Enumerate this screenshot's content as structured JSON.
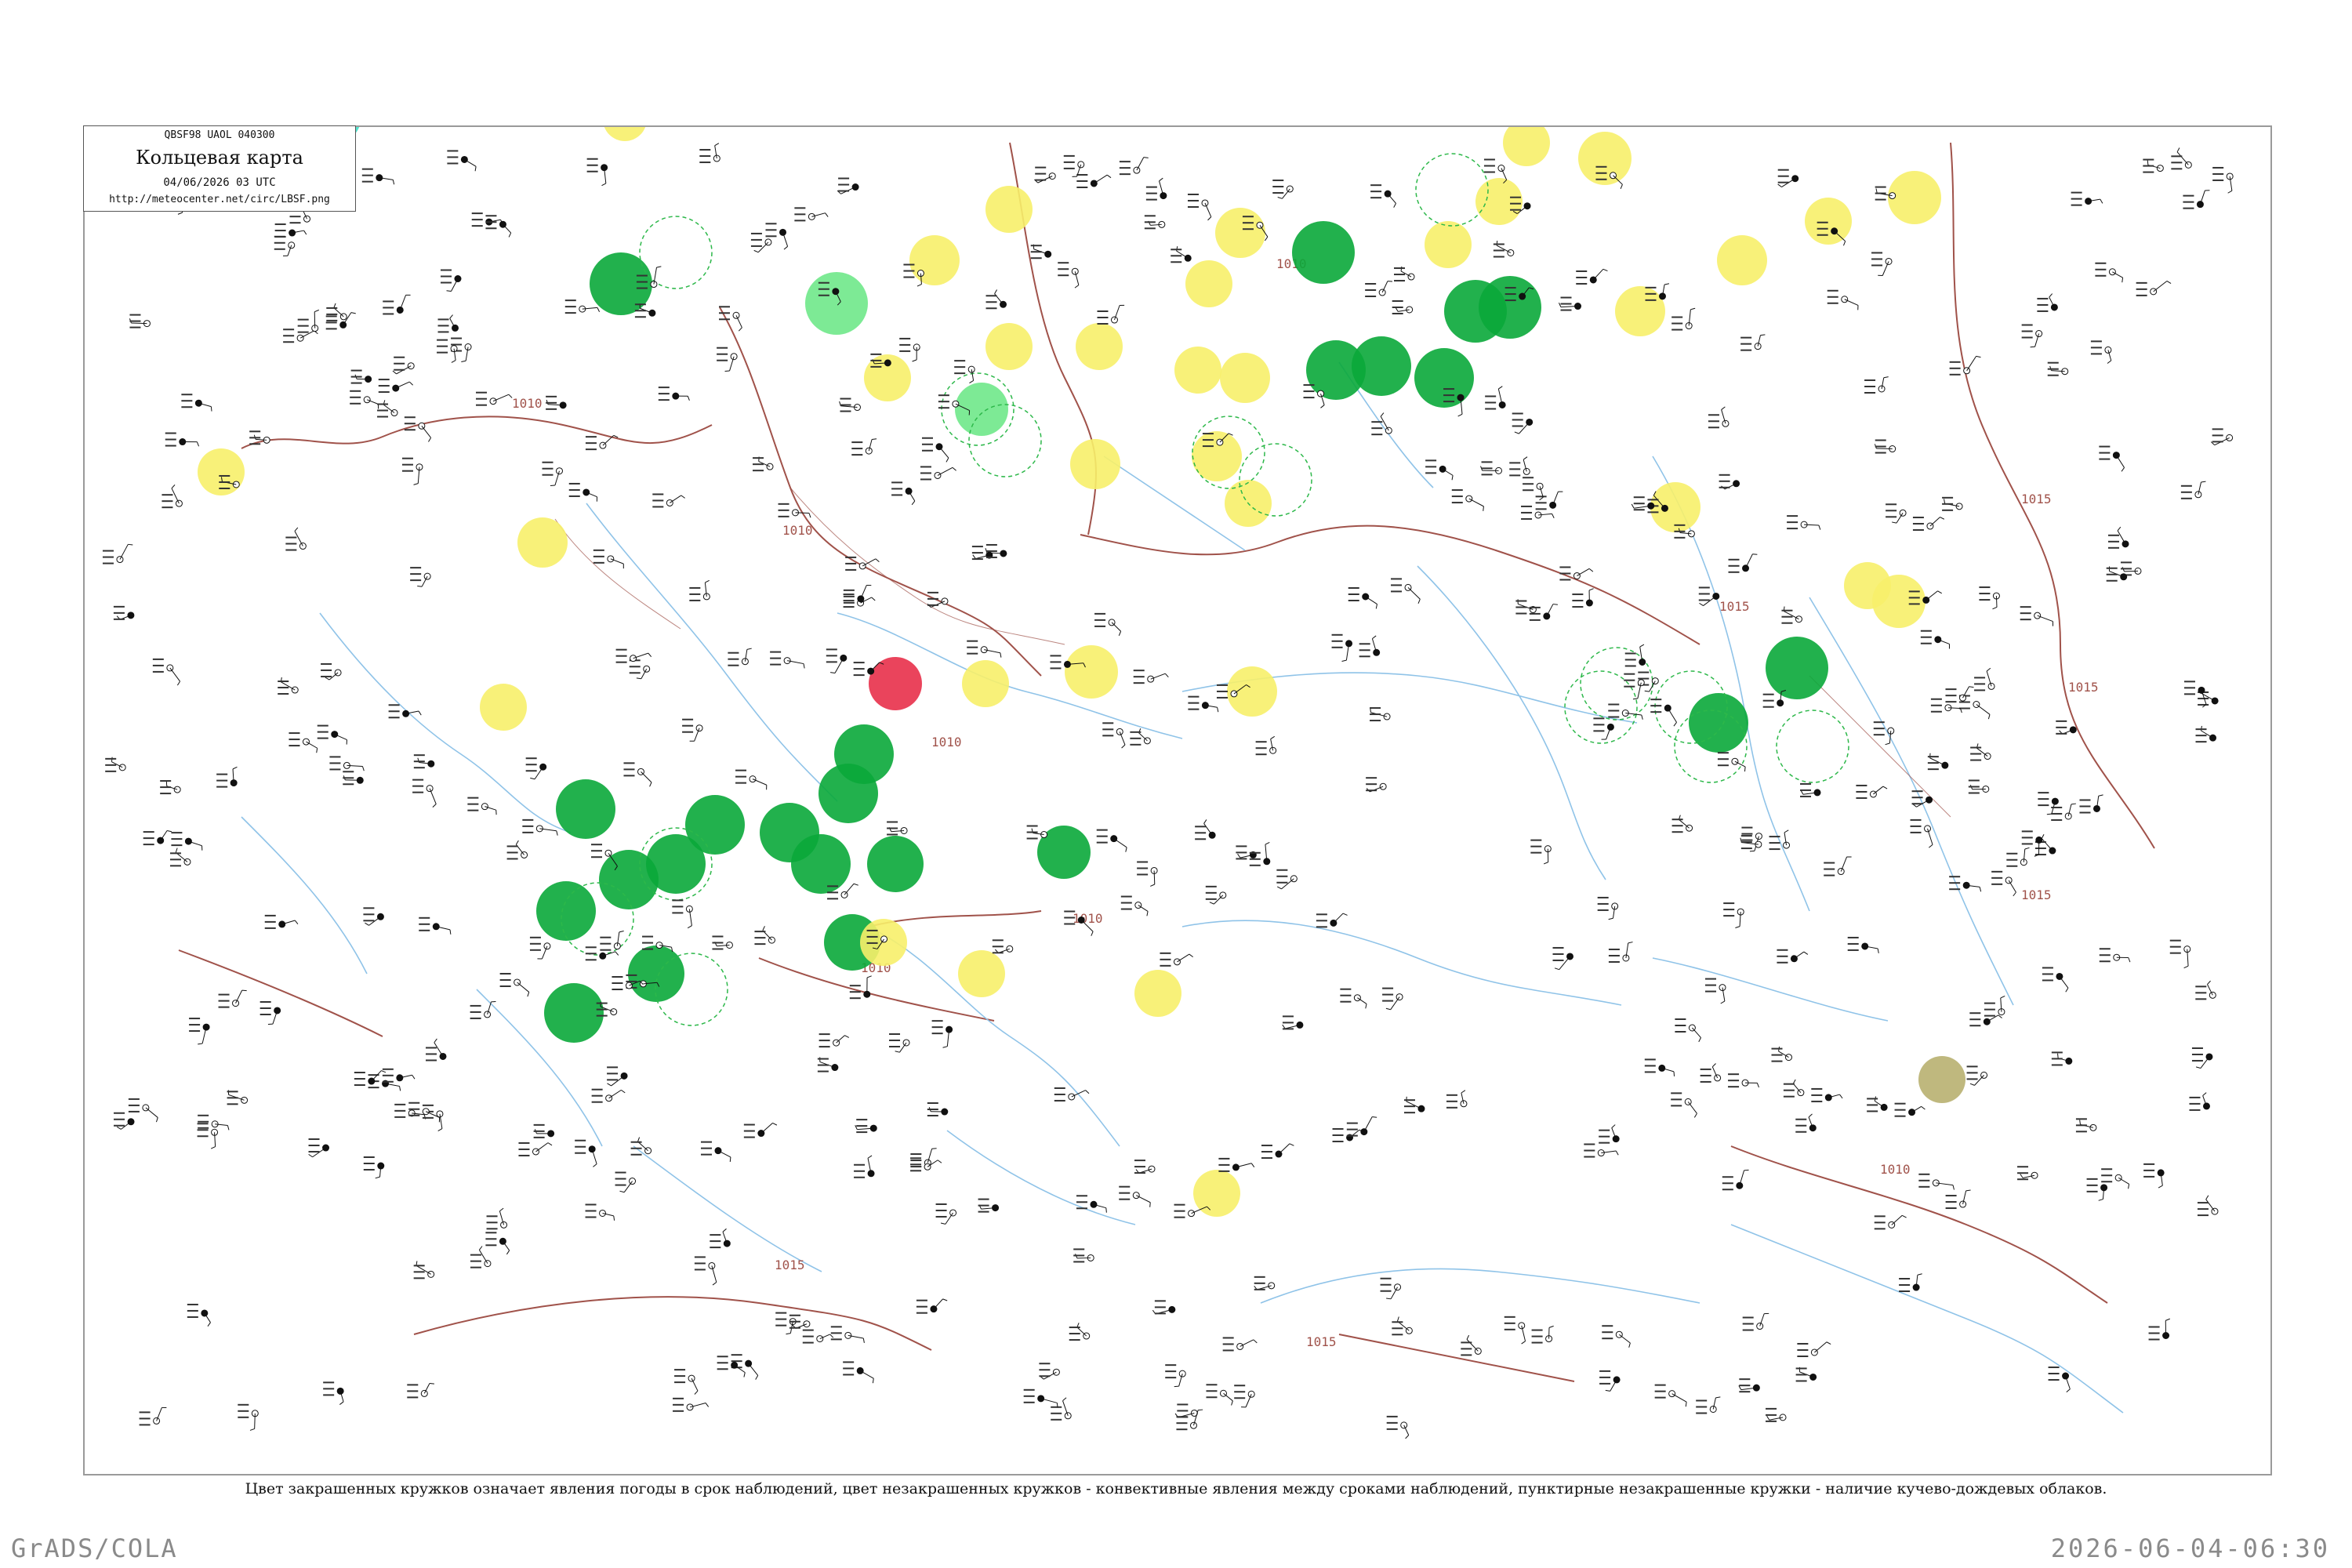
{
  "header": {
    "code": "QBSF98  UAOL  040300",
    "title": "Кольцевая карта",
    "datetime": "04/06/2026 03 UTC",
    "url": "http://meteocenter.net/circ/LBSF.png"
  },
  "legend_caption": "Цвет закрашенных кружков означает явления погоды в срок наблюдений, цвет незакрашенных кружков - конвективные явления между сроками наблюдений, пунктирные незакрашенные кружки - наличие кучево-дождевых облаков.",
  "footer": {
    "left": "GrADS/COLA",
    "right": "2026-06-04-06:30"
  },
  "colors": {
    "frame": "#9a9a9a",
    "border": "#a0524a",
    "river": "#8fc3e8",
    "isobar": "#a0524a",
    "green": "#0aa83a",
    "yellow": "#f7f06a",
    "cyan": "#3fe0c8",
    "light_green": "#6fe88a",
    "orange": "#f0a040",
    "red": "#e8304a",
    "olive": "#b8b070",
    "dashed_circle": "#2db84a"
  },
  "isobars": [
    "1010",
    "1010",
    "1010",
    "1010",
    "1010",
    "1010",
    "1015",
    "1015",
    "1015",
    "1015",
    "1015",
    "1015",
    "1010"
  ]
}
